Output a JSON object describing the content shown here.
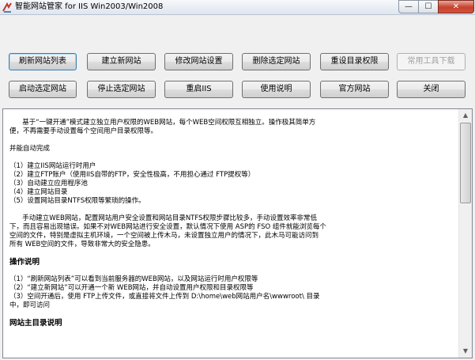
{
  "window": {
    "title": "智能网站管家 for IIS Win2003/Win2008",
    "minimize": "—",
    "maximize": "☐",
    "close": "✕"
  },
  "toolbar": {
    "row1": [
      {
        "label": "刷新网站列表",
        "enabled": true
      },
      {
        "label": "建立新网站",
        "enabled": true
      },
      {
        "label": "修改网站设置",
        "enabled": true
      },
      {
        "label": "删除选定网站",
        "enabled": true
      },
      {
        "label": "重设目录权限",
        "enabled": true
      },
      {
        "label": "常用工具下载",
        "enabled": false
      }
    ],
    "row2": [
      {
        "label": "启动选定网站",
        "enabled": true
      },
      {
        "label": "停止选定网站",
        "enabled": true
      },
      {
        "label": "重启IIS",
        "enabled": true
      },
      {
        "label": "使用说明",
        "enabled": true
      },
      {
        "label": "官方网站",
        "enabled": true
      },
      {
        "label": "关闭",
        "enabled": true
      }
    ]
  },
  "help": {
    "lines": [
      {
        "text": "      基于“一键开通”模式建立独立用户权限的WEB网站，每个WEB空间权限互相独立。操作极其简单方",
        "bold": false
      },
      {
        "text": "便，不再需要手动设置每个空间用户目录权限等。",
        "bold": false
      },
      {
        "text": "",
        "bold": false
      },
      {
        "text": "并能自动完成",
        "bold": false
      },
      {
        "text": "",
        "bold": false
      },
      {
        "text": "（1）建立IIS网站运行时用户",
        "bold": false
      },
      {
        "text": "（2）建立FTP账户（使用IIS自带的FTP，安全性极高，不用担心通过 FTP提权等）",
        "bold": false
      },
      {
        "text": "（3）自动建立应用程序池",
        "bold": false
      },
      {
        "text": "（4）建立网站目录",
        "bold": false
      },
      {
        "text": "（5）设置网站目录NTFS权限等繁琐的操作。",
        "bold": false
      },
      {
        "text": "",
        "bold": false
      },
      {
        "text": "      手动建立WEB网站，配置网站用户安全设置和网站目录NTFS权限步骤比较多，手动设置效率非常低",
        "bold": false
      },
      {
        "text": "下，而且容易出现错误。如果不对WEB网站进行安全设置，默认情况下使用 ASP的 FSO 组件就能浏览每个",
        "bold": false
      },
      {
        "text": "空间的文件，特别是虚拟主机环境，一个空间被上传木马，未设置独立用户的情况下，此木马可能访问到",
        "bold": false
      },
      {
        "text": "所有 WEB空间的文件，导致非常大的安全隐患。",
        "bold": false
      },
      {
        "text": "",
        "bold": false
      },
      {
        "text": "操作说明",
        "bold": true
      },
      {
        "text": "",
        "bold": false
      },
      {
        "text": "（1）“刷新网站列表”可以看到当前服务器的WEB网站，以及网站运行时用户权限等",
        "bold": false
      },
      {
        "text": "（2）“建立新网站”可以开通一个新 WEB网站，并自动设置用户权限和目录权限等",
        "bold": false
      },
      {
        "text": "（3）空间开通后，使用 FTP上传文件，或直接将文件上传到 D:\\home\\web网站用户名\\wwwroot\\ 目录",
        "bold": false
      },
      {
        "text": "中，即可访问",
        "bold": false
      },
      {
        "text": "",
        "bold": false
      },
      {
        "text": "网站主目录说明",
        "bold": true
      }
    ]
  },
  "scrollbar": {
    "up": "▲",
    "down": "▼"
  }
}
